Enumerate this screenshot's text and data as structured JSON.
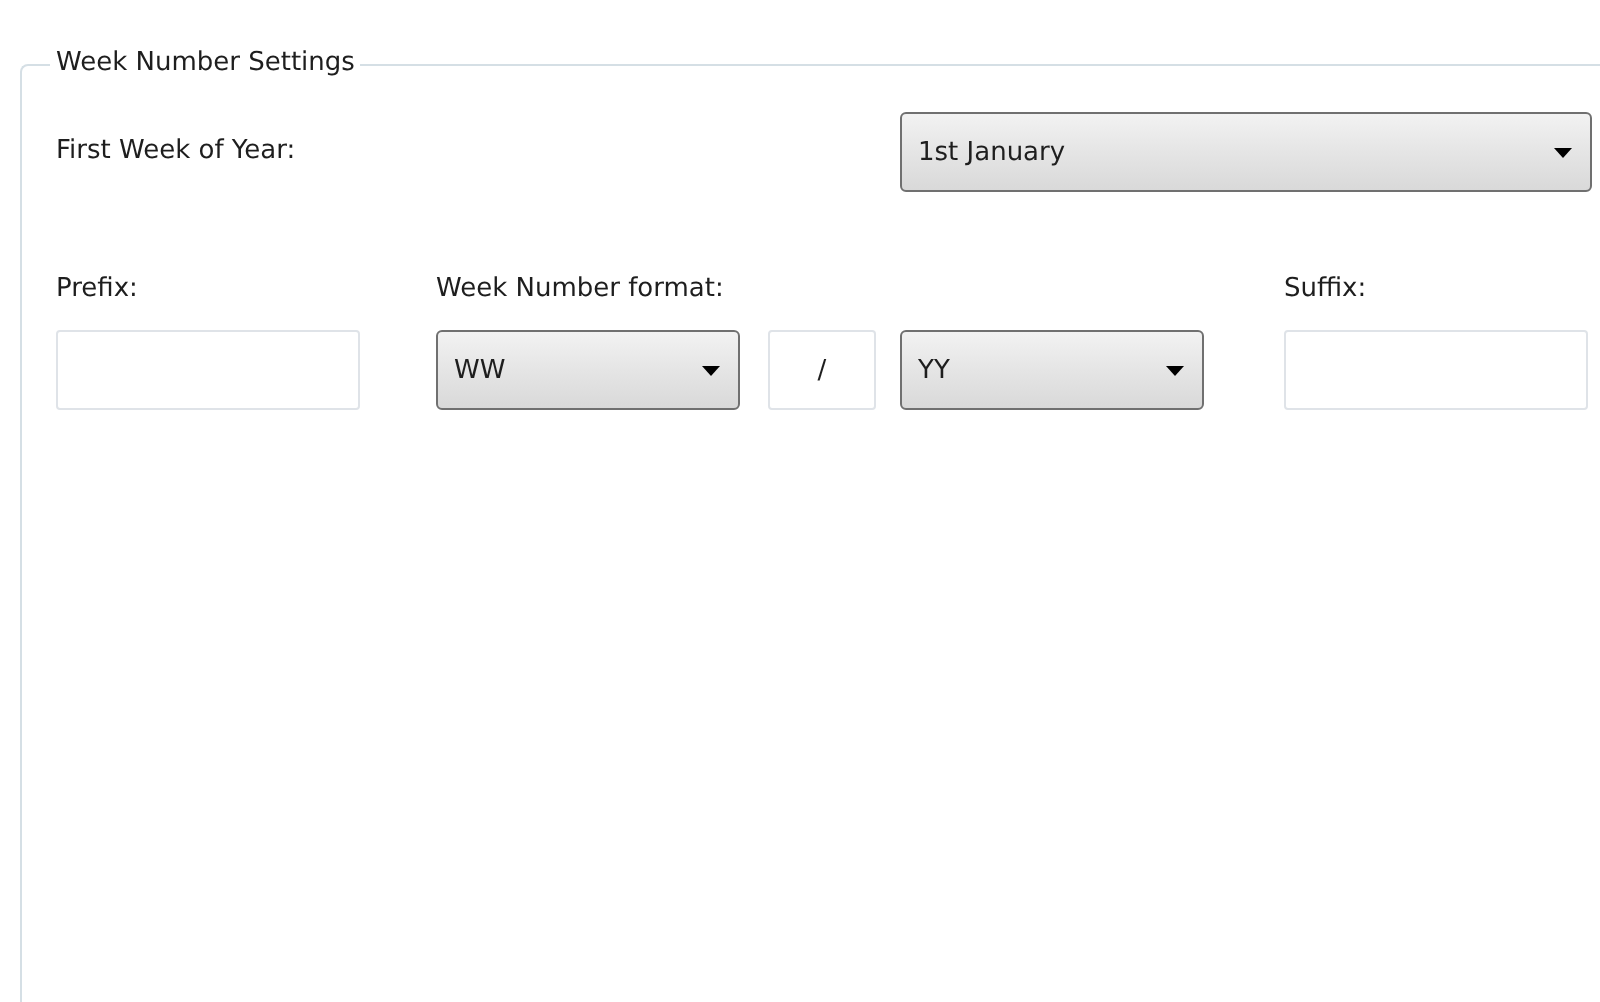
{
  "group": {
    "title": "Week Number Settings"
  },
  "first_week": {
    "label": "First Week of Year:",
    "value": "1st January"
  },
  "labels": {
    "prefix": "Prefix:",
    "format": "Week Number format:",
    "suffix": "Suffix:"
  },
  "format_row": [
    {
      "kind": "field"
    },
    {
      "kind": "combo",
      "value": "WW"
    },
    {
      "kind": "field",
      "value": "/"
    },
    {
      "kind": "combo",
      "value": "YY"
    },
    {
      "kind": "field"
    }
  ]
}
